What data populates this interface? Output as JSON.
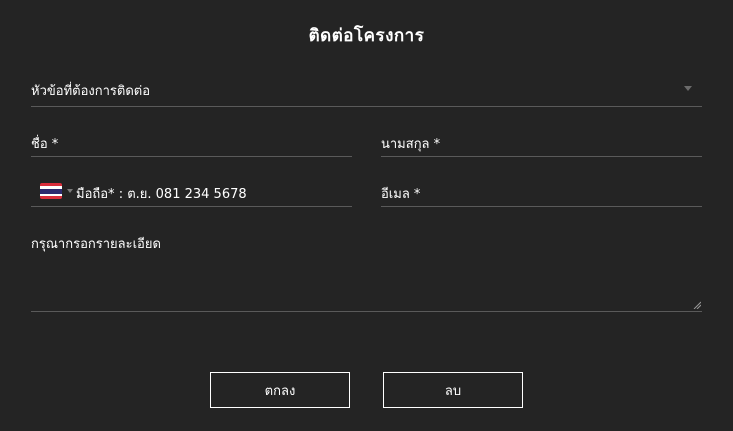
{
  "form": {
    "title": "ติดต่อโครงการ",
    "subject_placeholder": "หัวข้อที่ต้องการติดต่อ",
    "firstname_placeholder": "ชื่อ *",
    "lastname_placeholder": "นามสกุล *",
    "phone_placeholder": "มือถือ* : ต.ย. 081 234 5678",
    "email_placeholder": "อีเมล *",
    "details_placeholder": "กรุณากรอกรายละเอียด",
    "country_flag": "thailand-flag-icon"
  },
  "buttons": {
    "submit_label": "ตกลง",
    "clear_label": "ลบ"
  },
  "colors": {
    "background": "#242424",
    "text": "#ffffff",
    "underline": "#5a5a5a"
  }
}
